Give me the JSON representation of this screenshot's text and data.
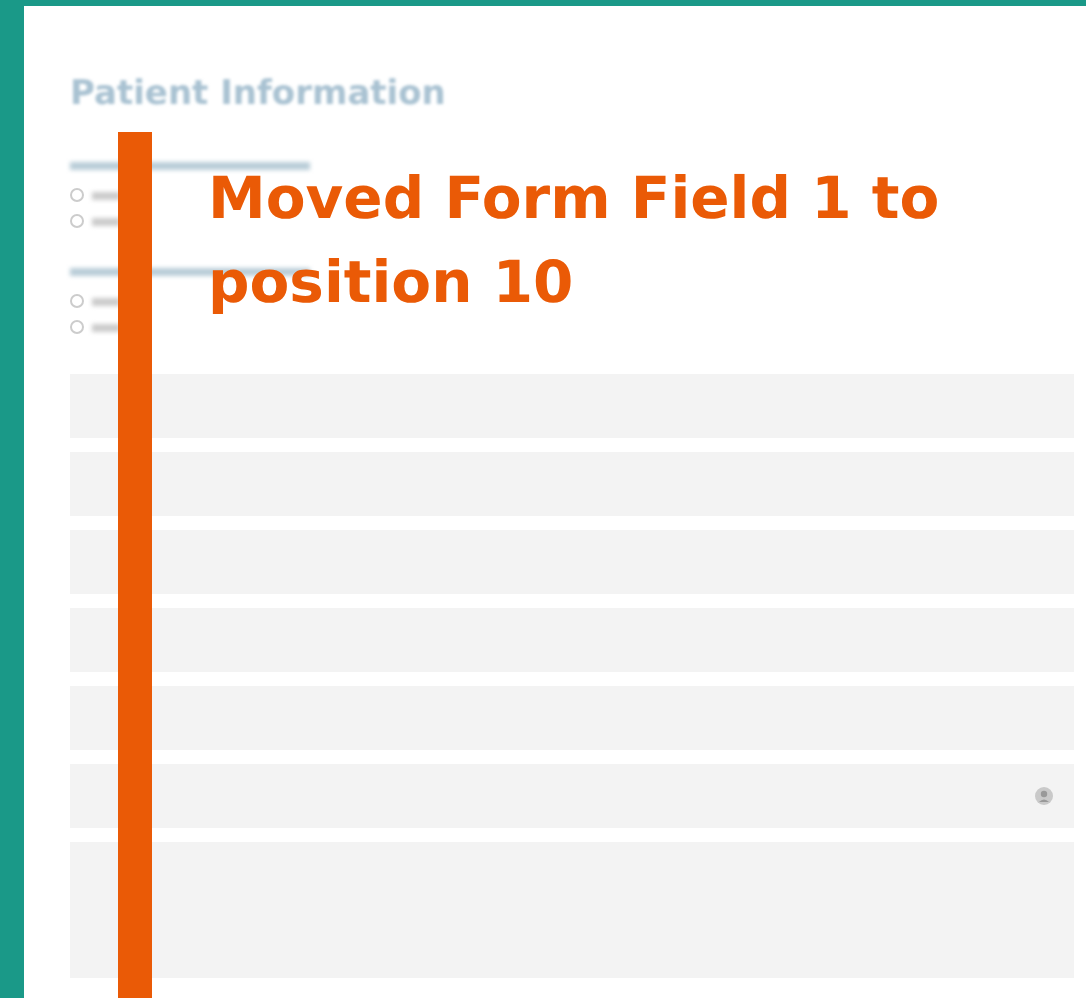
{
  "form": {
    "title": "Patient Information",
    "fields": [
      {
        "kind": "radio_group",
        "options": [
          {
            "selected": false
          },
          {
            "selected": false
          }
        ]
      },
      {
        "kind": "radio_group",
        "options": [
          {
            "selected": false
          },
          {
            "selected": false
          }
        ]
      },
      {
        "kind": "text"
      },
      {
        "kind": "text"
      },
      {
        "kind": "text"
      },
      {
        "kind": "text"
      },
      {
        "kind": "text"
      },
      {
        "kind": "email"
      },
      {
        "kind": "textarea"
      }
    ]
  },
  "annotation": {
    "text": "Moved Form Field 1 to position 10"
  }
}
